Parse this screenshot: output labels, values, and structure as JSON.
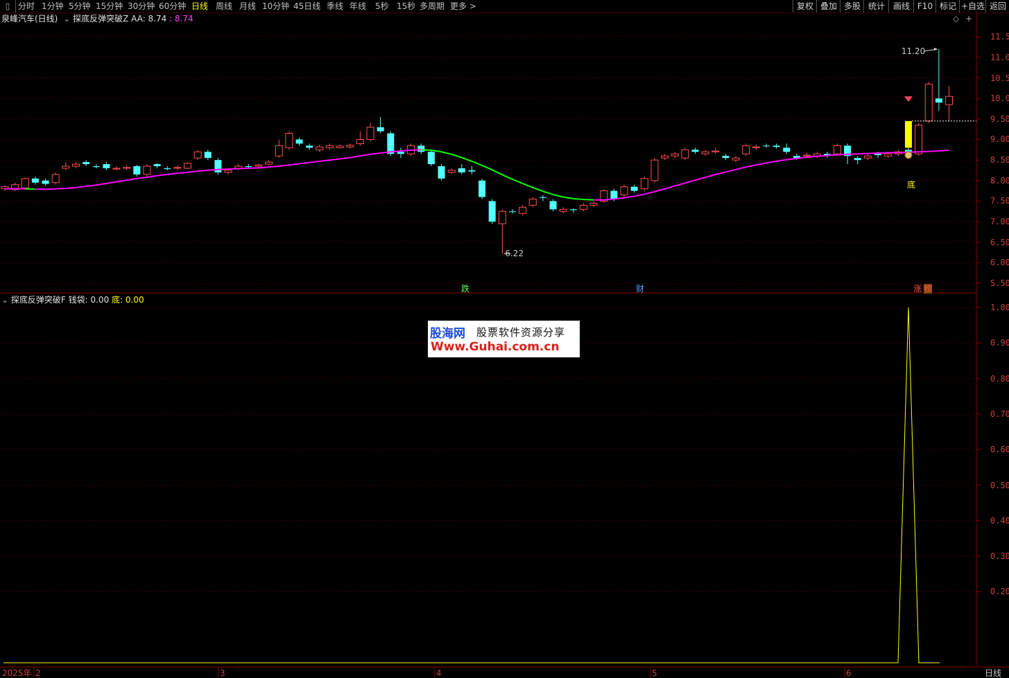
{
  "toolbar": {
    "periods": [
      "分时",
      "1分钟",
      "5分钟",
      "15分钟",
      "30分钟",
      "60分钟",
      "日线",
      "周线",
      "月线",
      "10分钟",
      "45日线",
      "季线",
      "年线",
      "5秒",
      "15秒",
      "多周期",
      "更多 >"
    ],
    "active": "日线",
    "right_buttons": [
      "复权",
      "叠加",
      "多股",
      "统计",
      "画线",
      "F10",
      "标记",
      "+自选",
      "返回"
    ]
  },
  "main_panel": {
    "stock_name": "泉峰汽车(日线)",
    "indicator": "探底反弹突破Z",
    "aa_label": "AA: 8.74",
    "aa_value2": ": 8.74",
    "price_ticks": [
      "11.50",
      "11.00",
      "10.50",
      "10.00",
      "9.50",
      "9.00",
      "8.50",
      "8.00",
      "7.50",
      "7.00",
      "6.50",
      "6.00",
      "5.50"
    ],
    "high_label": "11.20",
    "low_label": "6.22",
    "signal_label": "底",
    "markers": [
      "跌",
      "财",
      "涨",
      "榜"
    ]
  },
  "sub_panel": {
    "indicator": "探底反弹突破F",
    "qd_label": "钱袋: 0.00",
    "di_label": "底: 0.00",
    "ticks": [
      "1.00",
      "0.90",
      "0.80",
      "0.70",
      "0.60",
      "0.50",
      "0.40",
      "0.30",
      "0.20"
    ]
  },
  "date_axis": {
    "year": "2025年",
    "months": [
      "2",
      "3",
      "4",
      "5",
      "6"
    ],
    "period_label": "日线"
  },
  "watermark": {
    "brand": "股海网",
    "slogan": "股票软件资源分享",
    "url": "Www.Guhai.com.cn"
  },
  "colors": {
    "up": "#ff5050",
    "down": "#54ffff",
    "ma_up": "#ff00ff",
    "ma_down": "#00ff00",
    "signal": "#ffff00"
  },
  "chart_data": [
    {
      "type": "candlestick",
      "price_range": [
        5.4,
        11.9
      ],
      "high": 11.2,
      "low": 6.22,
      "candles": [
        [
          7.8,
          7.85,
          7.75,
          7.88
        ],
        [
          7.78,
          7.9,
          7.75,
          7.95
        ],
        [
          7.82,
          8.05,
          7.78,
          8.08
        ],
        [
          8.05,
          7.95,
          7.9,
          8.1
        ],
        [
          8.0,
          7.92,
          7.88,
          8.05
        ],
        [
          7.95,
          8.15,
          7.9,
          8.2
        ],
        [
          8.3,
          8.35,
          8.25,
          8.45
        ],
        [
          8.35,
          8.4,
          8.3,
          8.45
        ],
        [
          8.45,
          8.4,
          8.35,
          8.5
        ],
        [
          8.35,
          8.33,
          8.3,
          8.4
        ],
        [
          8.4,
          8.3,
          8.25,
          8.45
        ],
        [
          8.28,
          8.3,
          8.25,
          8.35
        ],
        [
          8.3,
          8.32,
          8.25,
          8.38
        ],
        [
          8.35,
          8.15,
          8.1,
          8.38
        ],
        [
          8.15,
          8.35,
          8.1,
          8.4
        ],
        [
          8.4,
          8.35,
          8.3,
          8.42
        ],
        [
          8.3,
          8.28,
          8.25,
          8.35
        ],
        [
          8.3,
          8.32,
          8.25,
          8.38
        ],
        [
          8.3,
          8.42,
          8.28,
          8.45
        ],
        [
          8.55,
          8.7,
          8.5,
          8.75
        ],
        [
          8.7,
          8.55,
          8.5,
          8.75
        ],
        [
          8.5,
          8.2,
          8.15,
          8.55
        ],
        [
          8.2,
          8.25,
          8.15,
          8.3
        ],
        [
          8.3,
          8.35,
          8.25,
          8.4
        ],
        [
          8.35,
          8.33,
          8.3,
          8.4
        ],
        [
          8.35,
          8.38,
          8.3,
          8.42
        ],
        [
          8.4,
          8.45,
          8.38,
          8.5
        ],
        [
          8.6,
          8.85,
          8.55,
          9.0
        ],
        [
          8.8,
          9.15,
          8.75,
          9.2
        ],
        [
          9.0,
          8.9,
          8.85,
          9.05
        ],
        [
          8.85,
          8.8,
          8.75,
          8.9
        ],
        [
          8.75,
          8.82,
          8.7,
          8.88
        ],
        [
          8.8,
          8.85,
          8.75,
          8.9
        ],
        [
          8.8,
          8.84,
          8.78,
          8.88
        ],
        [
          8.82,
          8.86,
          8.78,
          8.9
        ],
        [
          8.9,
          9.0,
          8.85,
          9.2
        ],
        [
          9.0,
          9.3,
          8.95,
          9.4
        ],
        [
          9.3,
          9.2,
          9.15,
          9.55
        ],
        [
          9.15,
          8.65,
          8.6,
          9.2
        ],
        [
          8.7,
          8.65,
          8.55,
          8.8
        ],
        [
          8.65,
          8.85,
          8.6,
          8.9
        ],
        [
          8.85,
          8.7,
          8.65,
          8.9
        ],
        [
          8.7,
          8.4,
          8.35,
          8.75
        ],
        [
          8.35,
          8.05,
          8.0,
          8.4
        ],
        [
          8.2,
          8.25,
          8.15,
          8.3
        ],
        [
          8.3,
          8.2,
          8.15,
          8.4
        ],
        [
          8.25,
          8.22,
          8.15,
          8.35
        ],
        [
          8.0,
          7.6,
          7.55,
          8.05
        ],
        [
          7.5,
          7.0,
          6.95,
          7.55
        ],
        [
          6.95,
          7.25,
          6.22,
          7.3
        ],
        [
          7.25,
          7.24,
          7.2,
          7.3
        ],
        [
          7.2,
          7.35,
          7.15,
          7.4
        ],
        [
          7.4,
          7.55,
          7.35,
          7.6
        ],
        [
          7.6,
          7.58,
          7.5,
          7.65
        ],
        [
          7.5,
          7.3,
          7.25,
          7.55
        ],
        [
          7.25,
          7.3,
          7.2,
          7.35
        ],
        [
          7.3,
          7.28,
          7.22,
          7.32
        ],
        [
          7.3,
          7.4,
          7.25,
          7.45
        ],
        [
          7.4,
          7.45,
          7.35,
          7.5
        ],
        [
          7.5,
          7.75,
          7.45,
          7.8
        ],
        [
          7.75,
          7.55,
          7.5,
          7.8
        ],
        [
          7.65,
          7.85,
          7.6,
          7.9
        ],
        [
          7.85,
          7.75,
          7.7,
          7.9
        ],
        [
          7.8,
          8.05,
          7.75,
          8.1
        ],
        [
          8.0,
          8.5,
          7.95,
          8.55
        ],
        [
          8.55,
          8.6,
          8.5,
          8.65
        ],
        [
          8.6,
          8.65,
          8.55,
          8.7
        ],
        [
          8.55,
          8.75,
          8.5,
          8.8
        ],
        [
          8.75,
          8.7,
          8.65,
          8.8
        ],
        [
          8.65,
          8.7,
          8.6,
          8.75
        ],
        [
          8.7,
          8.72,
          8.65,
          8.8
        ],
        [
          8.6,
          8.55,
          8.5,
          8.65
        ],
        [
          8.5,
          8.55,
          8.45,
          8.6
        ],
        [
          8.65,
          8.85,
          8.6,
          8.9
        ],
        [
          8.8,
          8.82,
          8.75,
          8.88
        ],
        [
          8.85,
          8.84,
          8.8,
          8.9
        ],
        [
          8.85,
          8.82,
          8.78,
          8.9
        ],
        [
          8.8,
          8.7,
          8.65,
          8.9
        ],
        [
          8.6,
          8.55,
          8.5,
          8.65
        ],
        [
          8.6,
          8.62,
          8.55,
          8.68
        ],
        [
          8.6,
          8.65,
          8.55,
          8.7
        ],
        [
          8.65,
          8.62,
          8.55,
          8.7
        ],
        [
          8.65,
          8.85,
          8.6,
          8.9
        ],
        [
          8.85,
          8.6,
          8.4,
          8.9
        ],
        [
          8.55,
          8.5,
          8.4,
          8.6
        ],
        [
          8.55,
          8.6,
          8.5,
          8.65
        ],
        [
          8.65,
          8.62,
          8.55,
          8.7
        ],
        [
          8.6,
          8.65,
          8.55,
          8.7
        ],
        [
          8.65,
          8.7,
          8.6,
          8.75
        ],
        [
          8.75,
          8.6,
          8.55,
          8.8
        ],
        [
          8.65,
          9.35,
          8.6,
          9.4
        ],
        [
          9.45,
          10.35,
          9.4,
          10.4
        ],
        [
          10.0,
          9.9,
          9.7,
          11.2
        ],
        [
          9.85,
          10.05,
          9.45,
          10.3
        ]
      ],
      "ma": [
        7.8,
        7.8,
        7.8,
        7.79,
        7.79,
        7.8,
        7.81,
        7.83,
        7.86,
        7.89,
        7.93,
        7.97,
        8.01,
        8.05,
        8.08,
        8.12,
        8.15,
        8.18,
        8.2,
        8.23,
        8.25,
        8.27,
        8.28,
        8.29,
        8.3,
        8.31,
        8.33,
        8.35,
        8.38,
        8.41,
        8.44,
        8.47,
        8.5,
        8.53,
        8.56,
        8.6,
        8.64,
        8.67,
        8.7,
        8.72,
        8.74,
        8.75,
        8.74,
        8.7,
        8.64,
        8.56,
        8.47,
        8.37,
        8.26,
        8.14,
        8.03,
        7.93,
        7.83,
        7.74,
        7.66,
        7.6,
        7.56,
        7.54,
        7.53,
        7.53,
        7.55,
        7.58,
        7.62,
        7.67,
        7.73,
        7.8,
        7.87,
        7.94,
        8.01,
        8.08,
        8.15,
        8.21,
        8.27,
        8.33,
        8.38,
        8.43,
        8.47,
        8.51,
        8.54,
        8.57,
        8.59,
        8.61,
        8.63,
        8.64,
        8.65,
        8.66,
        8.67,
        8.68,
        8.68,
        8.69,
        8.7,
        8.71,
        8.72,
        8.74
      ]
    },
    {
      "type": "line",
      "y_range": [
        0,
        1
      ],
      "series": [
        {
          "values": [
            0,
            0,
            1,
            0,
            0
          ]
        }
      ]
    }
  ]
}
